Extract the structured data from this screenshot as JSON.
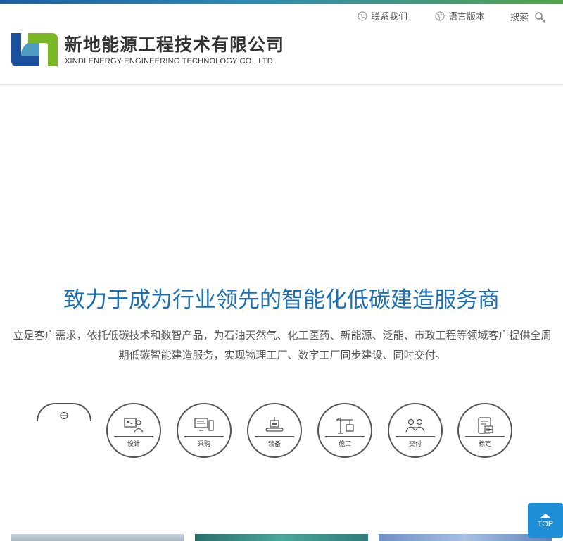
{
  "header": {
    "contact_label": "联系我们",
    "language_label": "语言版本",
    "search_label": "搜索",
    "company_name_cn": "新地能源工程技术有限公司",
    "company_name_en": "XINDI ENERGY ENGINEERING TECHNOLOGY CO., LTD."
  },
  "hero": {
    "slogan": "致力于成为行业领先的智能化低碳建造服务商",
    "description": "立足客户需求，依托低碳技术和数智产品，为石油天然气、化工医药、新能源、泛能、市政工程等领域客户提供全周期低碳智能建造服务，实现物理工厂、数字工厂同步建设、同时交付。"
  },
  "services": [
    {
      "label": "设计",
      "icon": "design-icon"
    },
    {
      "label": "采购",
      "icon": "procurement-icon"
    },
    {
      "label": "装备",
      "icon": "equipment-icon"
    },
    {
      "label": "施工",
      "icon": "construction-icon"
    },
    {
      "label": "交付",
      "icon": "delivery-icon"
    },
    {
      "label": "标定",
      "icon": "calibration-icon"
    }
  ],
  "back_to_top": {
    "label": "TOP"
  },
  "colors": {
    "brand_blue": "#1d6fb5",
    "top_button": "#1e8fd6",
    "logo_green": "#7ab828",
    "logo_blue": "#1c4f9c"
  }
}
